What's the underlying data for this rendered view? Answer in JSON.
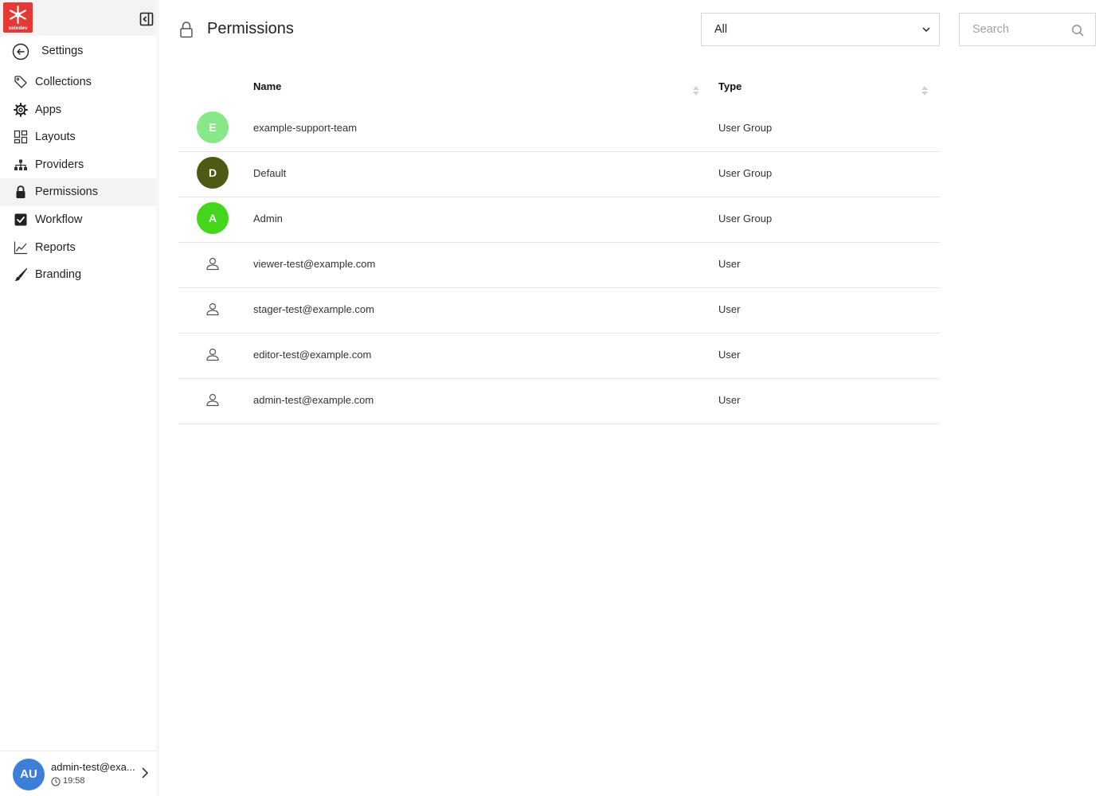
{
  "brand": {
    "logo_text": "solodev",
    "accent": "#e53935"
  },
  "sidebar": {
    "back_label": "Settings",
    "items": [
      {
        "label": "Collections",
        "icon": "tag-icon",
        "active": false
      },
      {
        "label": "Apps",
        "icon": "gear-icon",
        "active": false
      },
      {
        "label": "Layouts",
        "icon": "layout-grid-icon",
        "active": false
      },
      {
        "label": "Providers",
        "icon": "sitemap-icon",
        "active": false
      },
      {
        "label": "Permissions",
        "icon": "lock-icon",
        "active": true
      },
      {
        "label": "Workflow",
        "icon": "checkbox-icon",
        "active": false
      },
      {
        "label": "Reports",
        "icon": "line-chart-icon",
        "active": false
      },
      {
        "label": "Branding",
        "icon": "brush-icon",
        "active": false
      }
    ],
    "user": {
      "initials": "AU",
      "email": "admin-test@exa...",
      "time": "19:58",
      "avatar_color": "#3d7fd6"
    }
  },
  "header": {
    "title": "Permissions",
    "filter": {
      "selected": "All"
    },
    "search": {
      "placeholder": "Search",
      "value": ""
    }
  },
  "table": {
    "columns": {
      "name": "Name",
      "type": "Type"
    },
    "rows": [
      {
        "name": "example-support-team",
        "type": "User Group",
        "initial": "E",
        "avatar_color": "#86e886",
        "kind": "group"
      },
      {
        "name": "Default",
        "type": "User Group",
        "initial": "D",
        "avatar_color": "#4d5a13",
        "kind": "group"
      },
      {
        "name": "Admin",
        "type": "User Group",
        "initial": "A",
        "avatar_color": "#44d61a",
        "kind": "group"
      },
      {
        "name": "viewer-test@example.com",
        "type": "User",
        "initial": "",
        "avatar_color": "",
        "kind": "user"
      },
      {
        "name": "stager-test@example.com",
        "type": "User",
        "initial": "",
        "avatar_color": "",
        "kind": "user"
      },
      {
        "name": "editor-test@example.com",
        "type": "User",
        "initial": "",
        "avatar_color": "",
        "kind": "user"
      },
      {
        "name": "admin-test@example.com",
        "type": "User",
        "initial": "",
        "avatar_color": "",
        "kind": "user"
      }
    ]
  }
}
